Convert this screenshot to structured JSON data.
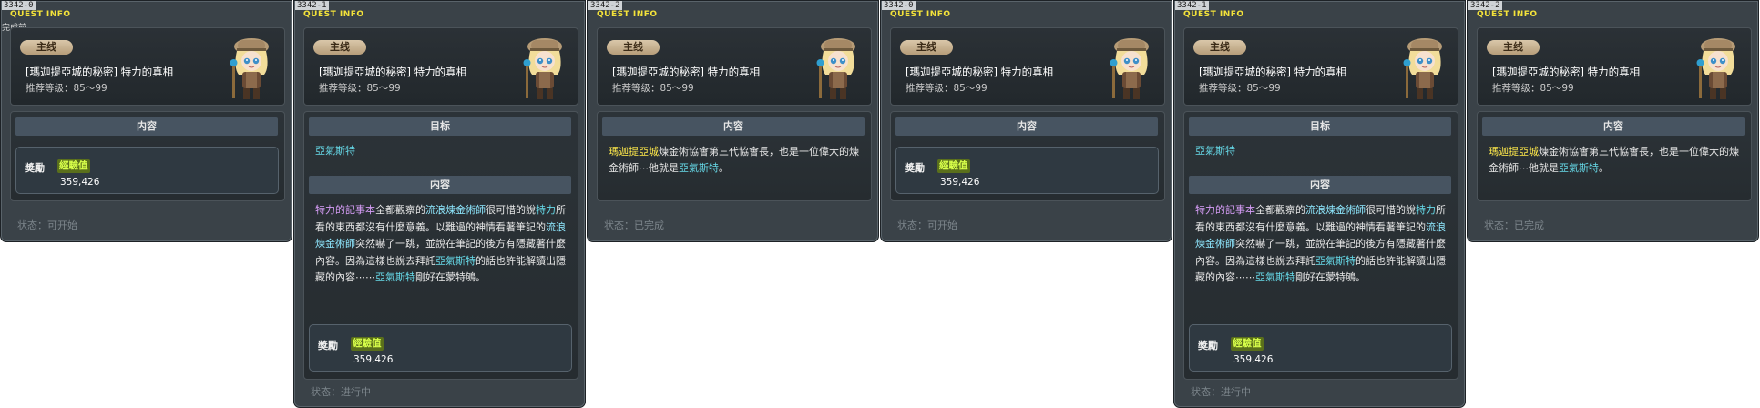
{
  "common": {
    "window_title": "QUEST INFO",
    "quest_type": "主线",
    "quest_name": "[瑪迦提亞城的秘密] 特力的真相",
    "recommended_level": "推荐等级：85～99",
    "content_header": "内容",
    "goal_header": "目标",
    "reward_label": "獎勵",
    "exp_label": "經驗值",
    "exp_value": "359,426"
  },
  "panels": [
    {
      "id": "3342-0",
      "subtitle": "完成前",
      "status": "状态：可开始",
      "variant": "start",
      "content_text": ""
    },
    {
      "id": "3342-1",
      "subtitle": "",
      "status": "状态：进行中",
      "variant": "progress",
      "goal_npc": "亞氣斯特",
      "content_runs": [
        {
          "t": "特力的記事本",
          "c": "item"
        },
        {
          "t": "全都觀察的",
          "c": ""
        },
        {
          "t": "流浪煉金術師",
          "c": "mob"
        },
        {
          "t": "很可惜的說",
          "c": ""
        },
        {
          "t": "特力",
          "c": "npc"
        },
        {
          "t": "所看的東西都沒有什麼意義。以難過的神情看著筆記的",
          "c": ""
        },
        {
          "t": "流浪煉金術師",
          "c": "mob"
        },
        {
          "t": "突然嚇了一跳，並說在筆記的後方有隱藏著什麼內容。因為這樣也說去拜託",
          "c": ""
        },
        {
          "t": "亞氣斯特",
          "c": "npc"
        },
        {
          "t": "的話也許能解讀出隱藏的內容⋯⋯",
          "c": ""
        },
        {
          "t": "亞氣斯特",
          "c": "npc"
        },
        {
          "t": "剛好在蒙特鴝。",
          "c": ""
        }
      ]
    },
    {
      "id": "3342-2",
      "subtitle": "",
      "status": "状态：已完成",
      "variant": "done",
      "content_runs": [
        {
          "t": "瑪迦提亞城",
          "c": "map"
        },
        {
          "t": "煉金術協會第三代協會長，也是一位偉大的煉金術師⋯他就是",
          "c": ""
        },
        {
          "t": "亞氣斯特",
          "c": "npc"
        },
        {
          "t": "。",
          "c": ""
        }
      ]
    },
    {
      "id": "3342-0",
      "subtitle": "",
      "status": "状态：可开始",
      "variant": "start"
    },
    {
      "id": "3342-1",
      "subtitle": "",
      "status": "状态：进行中",
      "variant": "progress",
      "goal_npc": "亞氣斯特",
      "content_runs": [
        {
          "t": "特力的記事本",
          "c": "item"
        },
        {
          "t": "全都觀察的",
          "c": ""
        },
        {
          "t": "流浪煉金術師",
          "c": "mob"
        },
        {
          "t": "很可惜的說",
          "c": ""
        },
        {
          "t": "特力",
          "c": "npc"
        },
        {
          "t": "所看的東西都沒有什麼意義。以難過的神情看著筆記的",
          "c": ""
        },
        {
          "t": "流浪煉金術師",
          "c": "mob"
        },
        {
          "t": "突然嚇了一跳，並說在筆記的後方有隱藏著什麼內容。因為這樣也說去拜託",
          "c": ""
        },
        {
          "t": "亞氣斯特",
          "c": "npc"
        },
        {
          "t": "的話也許能解讀出隱藏的內容⋯⋯",
          "c": ""
        },
        {
          "t": "亞氣斯特",
          "c": "npc"
        },
        {
          "t": "剛好在蒙特鴝。",
          "c": ""
        }
      ]
    },
    {
      "id": "3342-2",
      "subtitle": "",
      "status": "状态：已完成",
      "variant": "done",
      "content_runs": [
        {
          "t": "瑪迦提亞城",
          "c": "map"
        },
        {
          "t": "煉金術協會第三代協會長，也是一位偉大的煉金術師⋯他就是",
          "c": ""
        },
        {
          "t": "亞氣斯特",
          "c": "npc"
        },
        {
          "t": "。",
          "c": ""
        }
      ]
    }
  ],
  "colors": {
    "title_yellow": "#f4e33a",
    "npc_cyan": "#66d9e8",
    "item_purple": "#d59cf5",
    "map_yellow": "#ffe94a",
    "badge_tan": "#c9b38f"
  }
}
